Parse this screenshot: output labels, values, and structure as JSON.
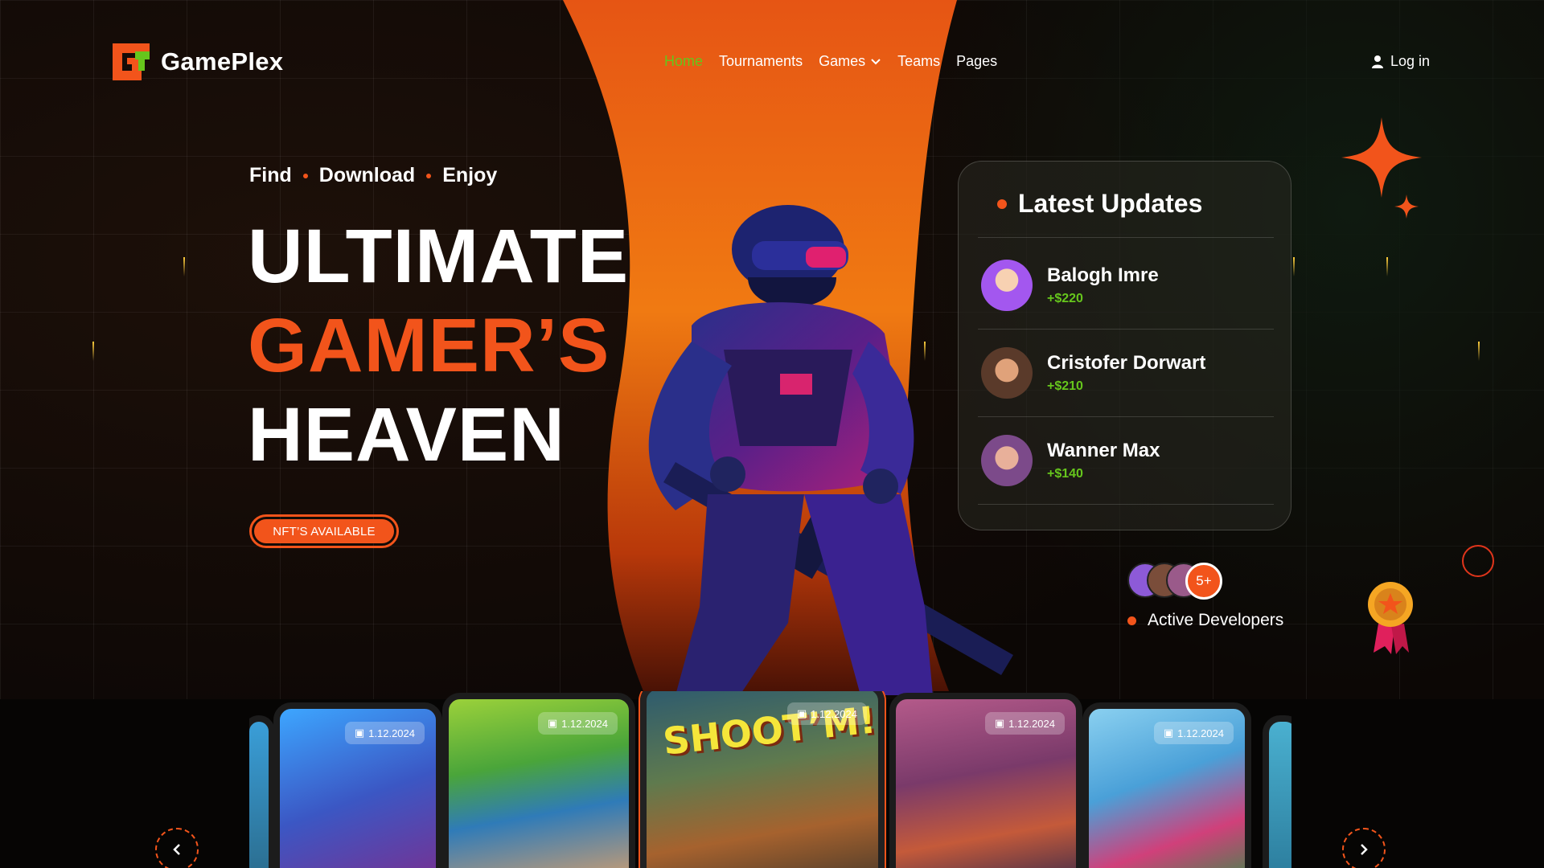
{
  "brand": {
    "name": "GamePlex"
  },
  "nav": {
    "items": [
      {
        "label": "Home",
        "active": true
      },
      {
        "label": "Tournaments",
        "active": false
      },
      {
        "label": "Games",
        "active": false,
        "dropdown": true
      },
      {
        "label": "Teams",
        "active": false
      },
      {
        "label": "Pages",
        "active": false
      }
    ],
    "login_label": "Log in"
  },
  "hero": {
    "tagline": [
      "Find",
      "Download",
      "Enjoy"
    ],
    "headline": [
      "ULTIMATE",
      "GAMER’S",
      "HEAVEN"
    ],
    "cta_label": "NFT’S AVAILABLE"
  },
  "updates": {
    "title": "Latest Updates",
    "items": [
      {
        "name": "Balogh Imre",
        "amount": "+$220"
      },
      {
        "name": "Cristofer Dorwart",
        "amount": "+$210"
      },
      {
        "name": "Wanner Max",
        "amount": "+$140"
      }
    ]
  },
  "developers": {
    "count_label": "5+",
    "label": "Active Developers"
  },
  "carousel": {
    "cards": [
      {
        "date": "1.12.2024",
        "title": ""
      },
      {
        "date": "1.12.2024",
        "title": ""
      },
      {
        "date": "1.12.2024",
        "title": "SHOOT’M!"
      },
      {
        "date": "1.12.2024",
        "title": ""
      },
      {
        "date": "1.12.2024",
        "title": ""
      }
    ],
    "prev_icon": "chevron-left-icon",
    "next_icon": "chevron-right-icon"
  },
  "colors": {
    "accent": "#f2541b",
    "active_nav": "#66c61c",
    "amount": "#66c61c",
    "background": "#0b0806"
  }
}
